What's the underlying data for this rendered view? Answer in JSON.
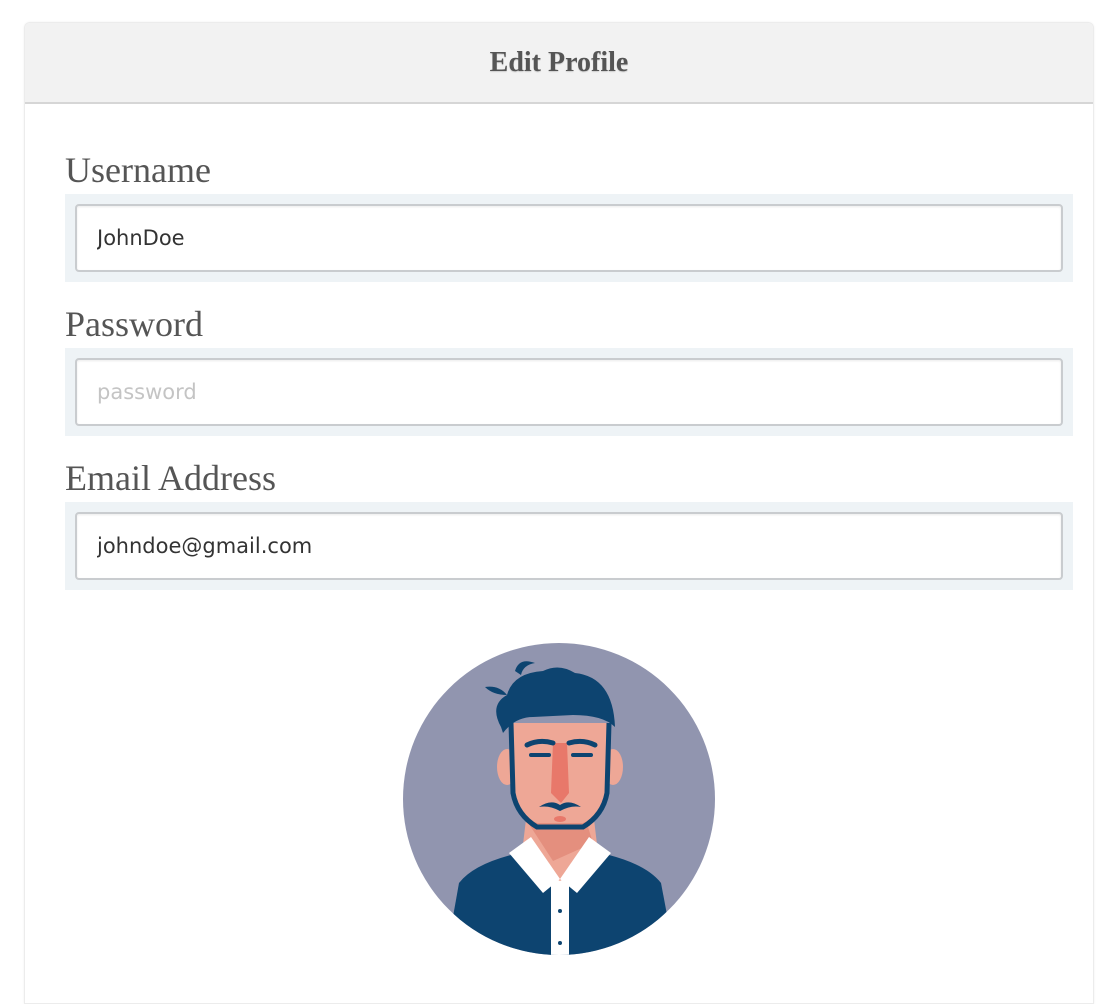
{
  "header": {
    "title": "Edit Profile"
  },
  "form": {
    "username": {
      "label": "Username",
      "value": "JohnDoe",
      "placeholder": ""
    },
    "password": {
      "label": "Password",
      "value": "",
      "placeholder": "password"
    },
    "email": {
      "label": "Email Address",
      "value": "johndoe@gmail.com",
      "placeholder": ""
    }
  },
  "avatar": {
    "icon": "profile-avatar-man-illustration"
  },
  "colors": {
    "header_bg": "#f2f2f2",
    "field_wrap_bg": "#eef3f6",
    "avatar_bg": "#9195af",
    "hair_shirt": "#0d4470",
    "skin": "#eea796",
    "text": "#555555"
  }
}
